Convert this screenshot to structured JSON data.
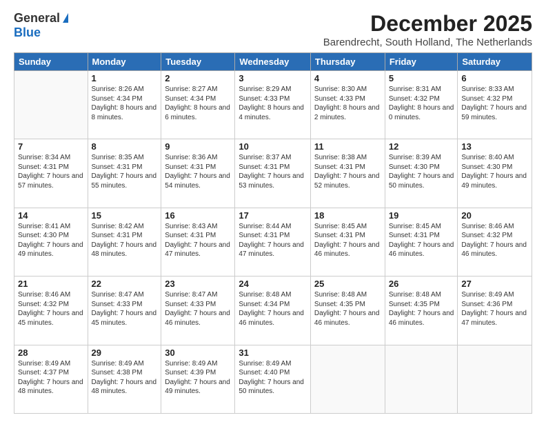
{
  "header": {
    "logo_general": "General",
    "logo_blue": "Blue",
    "month_title": "December 2025",
    "location": "Barendrecht, South Holland, The Netherlands"
  },
  "days_of_week": [
    "Sunday",
    "Monday",
    "Tuesday",
    "Wednesday",
    "Thursday",
    "Friday",
    "Saturday"
  ],
  "weeks": [
    [
      {
        "day": "",
        "sunrise": "",
        "sunset": "",
        "daylight": ""
      },
      {
        "day": "1",
        "sunrise": "Sunrise: 8:26 AM",
        "sunset": "Sunset: 4:34 PM",
        "daylight": "Daylight: 8 hours and 8 minutes."
      },
      {
        "day": "2",
        "sunrise": "Sunrise: 8:27 AM",
        "sunset": "Sunset: 4:34 PM",
        "daylight": "Daylight: 8 hours and 6 minutes."
      },
      {
        "day": "3",
        "sunrise": "Sunrise: 8:29 AM",
        "sunset": "Sunset: 4:33 PM",
        "daylight": "Daylight: 8 hours and 4 minutes."
      },
      {
        "day": "4",
        "sunrise": "Sunrise: 8:30 AM",
        "sunset": "Sunset: 4:33 PM",
        "daylight": "Daylight: 8 hours and 2 minutes."
      },
      {
        "day": "5",
        "sunrise": "Sunrise: 8:31 AM",
        "sunset": "Sunset: 4:32 PM",
        "daylight": "Daylight: 8 hours and 0 minutes."
      },
      {
        "day": "6",
        "sunrise": "Sunrise: 8:33 AM",
        "sunset": "Sunset: 4:32 PM",
        "daylight": "Daylight: 7 hours and 59 minutes."
      }
    ],
    [
      {
        "day": "7",
        "sunrise": "Sunrise: 8:34 AM",
        "sunset": "Sunset: 4:31 PM",
        "daylight": "Daylight: 7 hours and 57 minutes."
      },
      {
        "day": "8",
        "sunrise": "Sunrise: 8:35 AM",
        "sunset": "Sunset: 4:31 PM",
        "daylight": "Daylight: 7 hours and 55 minutes."
      },
      {
        "day": "9",
        "sunrise": "Sunrise: 8:36 AM",
        "sunset": "Sunset: 4:31 PM",
        "daylight": "Daylight: 7 hours and 54 minutes."
      },
      {
        "day": "10",
        "sunrise": "Sunrise: 8:37 AM",
        "sunset": "Sunset: 4:31 PM",
        "daylight": "Daylight: 7 hours and 53 minutes."
      },
      {
        "day": "11",
        "sunrise": "Sunrise: 8:38 AM",
        "sunset": "Sunset: 4:31 PM",
        "daylight": "Daylight: 7 hours and 52 minutes."
      },
      {
        "day": "12",
        "sunrise": "Sunrise: 8:39 AM",
        "sunset": "Sunset: 4:30 PM",
        "daylight": "Daylight: 7 hours and 50 minutes."
      },
      {
        "day": "13",
        "sunrise": "Sunrise: 8:40 AM",
        "sunset": "Sunset: 4:30 PM",
        "daylight": "Daylight: 7 hours and 49 minutes."
      }
    ],
    [
      {
        "day": "14",
        "sunrise": "Sunrise: 8:41 AM",
        "sunset": "Sunset: 4:30 PM",
        "daylight": "Daylight: 7 hours and 49 minutes."
      },
      {
        "day": "15",
        "sunrise": "Sunrise: 8:42 AM",
        "sunset": "Sunset: 4:31 PM",
        "daylight": "Daylight: 7 hours and 48 minutes."
      },
      {
        "day": "16",
        "sunrise": "Sunrise: 8:43 AM",
        "sunset": "Sunset: 4:31 PM",
        "daylight": "Daylight: 7 hours and 47 minutes."
      },
      {
        "day": "17",
        "sunrise": "Sunrise: 8:44 AM",
        "sunset": "Sunset: 4:31 PM",
        "daylight": "Daylight: 7 hours and 47 minutes."
      },
      {
        "day": "18",
        "sunrise": "Sunrise: 8:45 AM",
        "sunset": "Sunset: 4:31 PM",
        "daylight": "Daylight: 7 hours and 46 minutes."
      },
      {
        "day": "19",
        "sunrise": "Sunrise: 8:45 AM",
        "sunset": "Sunset: 4:31 PM",
        "daylight": "Daylight: 7 hours and 46 minutes."
      },
      {
        "day": "20",
        "sunrise": "Sunrise: 8:46 AM",
        "sunset": "Sunset: 4:32 PM",
        "daylight": "Daylight: 7 hours and 46 minutes."
      }
    ],
    [
      {
        "day": "21",
        "sunrise": "Sunrise: 8:46 AM",
        "sunset": "Sunset: 4:32 PM",
        "daylight": "Daylight: 7 hours and 45 minutes."
      },
      {
        "day": "22",
        "sunrise": "Sunrise: 8:47 AM",
        "sunset": "Sunset: 4:33 PM",
        "daylight": "Daylight: 7 hours and 45 minutes."
      },
      {
        "day": "23",
        "sunrise": "Sunrise: 8:47 AM",
        "sunset": "Sunset: 4:33 PM",
        "daylight": "Daylight: 7 hours and 46 minutes."
      },
      {
        "day": "24",
        "sunrise": "Sunrise: 8:48 AM",
        "sunset": "Sunset: 4:34 PM",
        "daylight": "Daylight: 7 hours and 46 minutes."
      },
      {
        "day": "25",
        "sunrise": "Sunrise: 8:48 AM",
        "sunset": "Sunset: 4:35 PM",
        "daylight": "Daylight: 7 hours and 46 minutes."
      },
      {
        "day": "26",
        "sunrise": "Sunrise: 8:48 AM",
        "sunset": "Sunset: 4:35 PM",
        "daylight": "Daylight: 7 hours and 46 minutes."
      },
      {
        "day": "27",
        "sunrise": "Sunrise: 8:49 AM",
        "sunset": "Sunset: 4:36 PM",
        "daylight": "Daylight: 7 hours and 47 minutes."
      }
    ],
    [
      {
        "day": "28",
        "sunrise": "Sunrise: 8:49 AM",
        "sunset": "Sunset: 4:37 PM",
        "daylight": "Daylight: 7 hours and 48 minutes."
      },
      {
        "day": "29",
        "sunrise": "Sunrise: 8:49 AM",
        "sunset": "Sunset: 4:38 PM",
        "daylight": "Daylight: 7 hours and 48 minutes."
      },
      {
        "day": "30",
        "sunrise": "Sunrise: 8:49 AM",
        "sunset": "Sunset: 4:39 PM",
        "daylight": "Daylight: 7 hours and 49 minutes."
      },
      {
        "day": "31",
        "sunrise": "Sunrise: 8:49 AM",
        "sunset": "Sunset: 4:40 PM",
        "daylight": "Daylight: 7 hours and 50 minutes."
      },
      {
        "day": "",
        "sunrise": "",
        "sunset": "",
        "daylight": ""
      },
      {
        "day": "",
        "sunrise": "",
        "sunset": "",
        "daylight": ""
      },
      {
        "day": "",
        "sunrise": "",
        "sunset": "",
        "daylight": ""
      }
    ]
  ]
}
